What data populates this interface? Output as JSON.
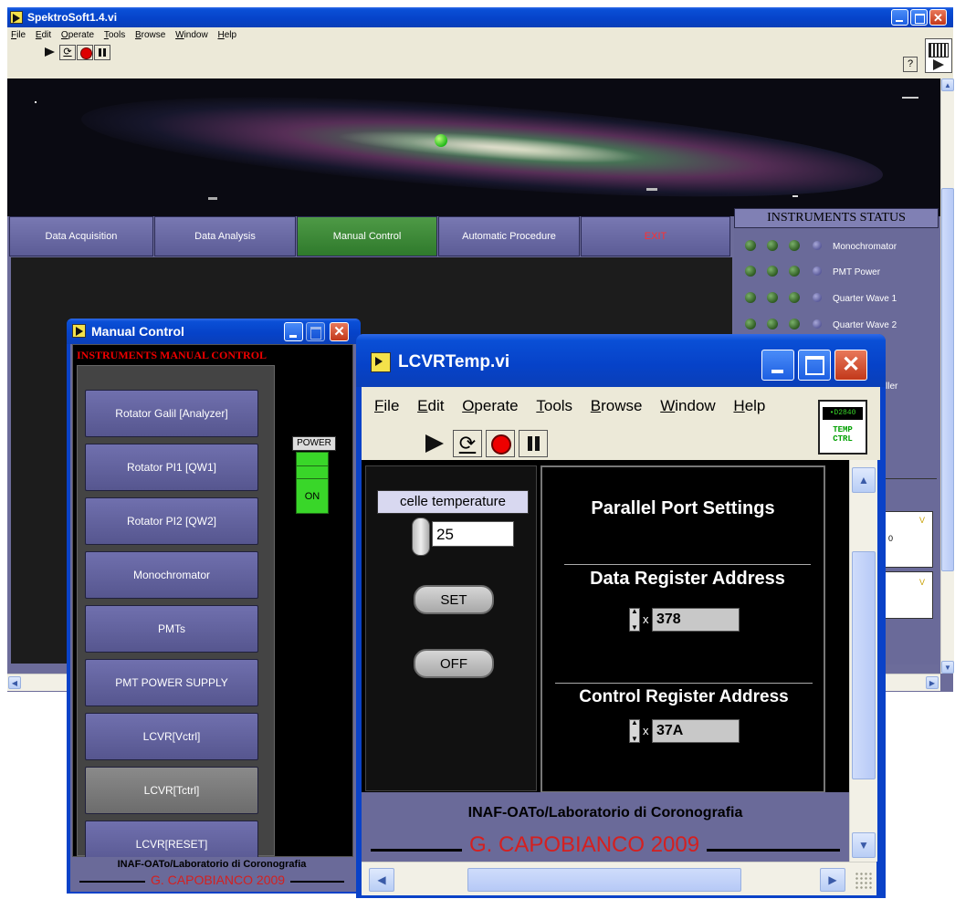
{
  "main_window": {
    "title": "SpektroSoft1.4.vi",
    "menu": [
      "File",
      "Edit",
      "Operate",
      "Tools",
      "Browse",
      "Window",
      "Help"
    ],
    "tabs": [
      {
        "label": "Data Acquisition"
      },
      {
        "label": "Data Analysis"
      },
      {
        "label": "Manual Control"
      },
      {
        "label": "Automatic Procedure"
      },
      {
        "label": "EXIT"
      }
    ],
    "status_panel": {
      "title": "INSTRUMENTS STATUS",
      "items": [
        "Monochromator",
        "PMT Power",
        "Quarter Wave 1",
        "Quarter Wave 2",
        "",
        "",
        "ller"
      ]
    },
    "help_icon": "?",
    "right_ticks": [
      "V",
      "0",
      "V"
    ]
  },
  "manual_control": {
    "title": "Manual Control",
    "header": "INSTRUMENTS  MANUAL CONTROL",
    "buttons": [
      "Rotator Galil [Analyzer]",
      "Rotator PI1 [QW1]",
      "Rotator PI2 [QW2]",
      "Monochromator",
      "PMTs",
      "PMT POWER SUPPLY",
      "LCVR[Vctrl]",
      "LCVR[Tctrl]",
      "LCVR[RESET]"
    ],
    "power_label": "POWER",
    "power_state": "ON",
    "footer_org": "INAF-OATo/Laboratorio di Coronografia",
    "footer_author": "G. CAPOBIANCO 2009"
  },
  "lcvr_window": {
    "title": "LCVRTemp.vi",
    "menu": [
      "File",
      "Edit",
      "Operate",
      "Tools",
      "Browse",
      "Window",
      "Help"
    ],
    "badge_top": "•D2840",
    "badge_bottom": "TEMP CTRL",
    "temp_label": "celle temperature",
    "temp_value": "25",
    "set_label": "SET",
    "off_label": "OFF",
    "parallel_title": "Parallel Port Settings",
    "data_reg_label": "Data Register Address",
    "data_reg_prefix": "x",
    "data_reg_value": "378",
    "ctrl_reg_label": "Control Register Address",
    "ctrl_reg_prefix": "x",
    "ctrl_reg_value": "37A",
    "footer_org": "INAF-OATo/Laboratorio di Coronografia",
    "footer_author": "G. CAPOBIANCO 2009"
  },
  "colors": {
    "accent_tab": "#3f8a3a",
    "exit_text": "#ff3030",
    "power_on": "#39d629",
    "author_text": "#d42020"
  }
}
